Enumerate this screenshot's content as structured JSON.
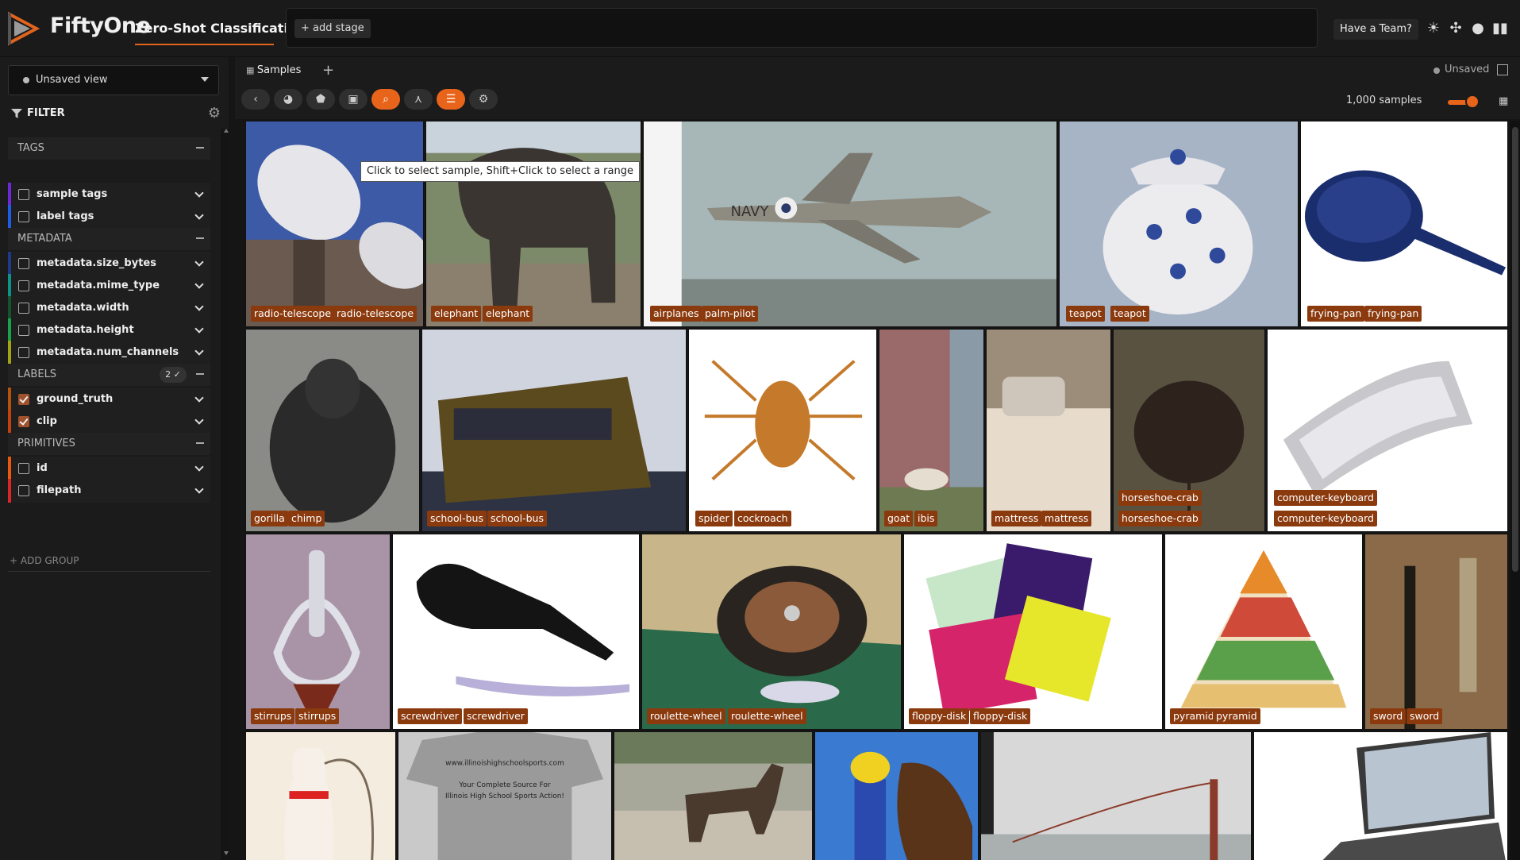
{
  "header": {
    "brand": "FiftyOne",
    "dataset_name": "Zero-Shot Classification",
    "add_stage_label": "+ add stage",
    "team_button": "Have a Team?",
    "icons": [
      "sun-icon",
      "slack-icon",
      "github-icon",
      "book-icon"
    ]
  },
  "sidebar": {
    "view_select": "Unsaved view",
    "filter_label": "FILTER",
    "groups": {
      "tags": "TAGS",
      "metadata": "METADATA",
      "labels": "LABELS",
      "primitives": "PRIMITIVES"
    },
    "labels_count": "2 ✓",
    "fields": {
      "sample_tags": "sample tags",
      "label_tags": "label tags",
      "size_bytes": "metadata.size_bytes",
      "mime_type": "metadata.mime_type",
      "width": "metadata.width",
      "height": "metadata.height",
      "num_channels": "metadata.num_channels",
      "ground_truth": "ground_truth",
      "clip": "clip",
      "id": "id",
      "filepath": "filepath"
    },
    "add_group": "+ ADD GROUP"
  },
  "tabs": {
    "samples": "Samples",
    "add": "+",
    "unsaved": "Unsaved"
  },
  "toolbar": {
    "sample_count": "1,000 samples"
  },
  "tooltip": "Click to select sample, Shift+Click to select a range",
  "samples": [
    {
      "gt": "radio-telescope",
      "pred": "radio-telescope"
    },
    {
      "gt": "elephant",
      "pred": "elephant"
    },
    {
      "gt": "airplanes",
      "pred": "palm-pilot"
    },
    {
      "gt": "teapot",
      "pred": "teapot"
    },
    {
      "gt": "frying-pan",
      "pred": "frying-pan"
    },
    {
      "gt": "gorilla",
      "pred": "chimp"
    },
    {
      "gt": "school-bus",
      "pred": "school-bus"
    },
    {
      "gt": "spider",
      "pred": "cockroach"
    },
    {
      "gt": "goat",
      "pred": "ibis"
    },
    {
      "gt": "mattress",
      "pred": "mattress"
    },
    {
      "gt": "horseshoe-crab",
      "pred": "horseshoe-crab"
    },
    {
      "gt": "computer-keyboard",
      "pred": "computer-keyboard"
    },
    {
      "gt": "stirrups",
      "pred": "stirrups"
    },
    {
      "gt": "screwdriver",
      "pred": "screwdriver"
    },
    {
      "gt": "roulette-wheel",
      "pred": "roulette-wheel"
    },
    {
      "gt": "floppy-disk",
      "pred": "floppy-disk"
    },
    {
      "gt": "pyramid",
      "pred": "pyramid"
    },
    {
      "gt": "sword",
      "pred": "sword"
    }
  ],
  "image_text": {
    "tshirt_line1": "www.illinoishighschoolsports.com",
    "tshirt_line2": "Your Complete Source For",
    "tshirt_line3": "Illinois High School Sports Action!",
    "plane_text": "NAVY"
  }
}
